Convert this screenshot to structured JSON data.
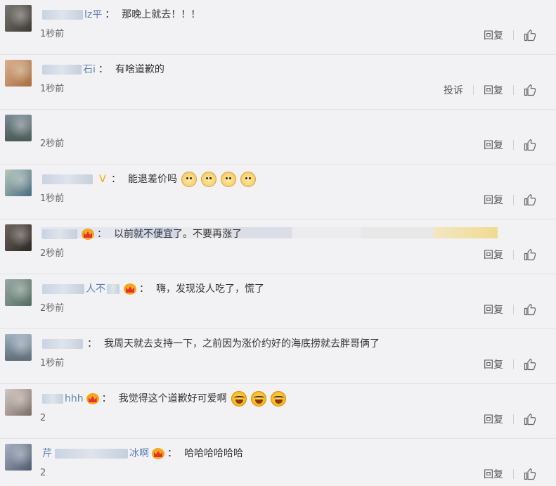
{
  "comments": [
    {
      "avatar": "avatar",
      "username_suffix": "lz平",
      "text": "那晚上就去！！！",
      "time": "1秒前",
      "reply_label": "回复",
      "report_label": ""
    },
    {
      "avatar": "avatar",
      "username_suffix": "石i",
      "text": "有啥道歉的",
      "time": "1秒前",
      "reply_label": "回复",
      "report_label": "投诉"
    },
    {
      "avatar": "avatar",
      "username_suffix": "",
      "text": "",
      "time": "2秒前",
      "reply_label": "回复",
      "report_label": ""
    },
    {
      "avatar": "avatar",
      "username_suffix": "",
      "text": "能退差价吗",
      "time": "1秒前",
      "reply_label": "回复",
      "report_label": ""
    },
    {
      "avatar": "avatar",
      "username_suffix": "",
      "text": "以前就不便宜了。不要再涨了",
      "time": "2秒前",
      "reply_label": "回复",
      "report_label": ""
    },
    {
      "avatar": "avatar",
      "username_suffix": "人不",
      "text": "嗨，发现没人吃了，慌了",
      "time": "2秒前",
      "reply_label": "回复",
      "report_label": ""
    },
    {
      "avatar": "avatar",
      "username_suffix": "",
      "text": "我周天就去支持一下，之前因为涨价约好的海底捞就去胖哥俩了",
      "time": "1秒前",
      "reply_label": "回复",
      "report_label": ""
    },
    {
      "avatar": "avatar",
      "username_suffix": "hhh",
      "text": "我觉得这个道歉好可爱啊",
      "time": "2",
      "reply_label": "回复",
      "report_label": ""
    },
    {
      "avatar": "avatar",
      "username_suffix": "冰啊",
      "username_prefix": "芹",
      "text": "哈哈哈哈哈哈",
      "time": "2",
      "reply_label": "回复",
      "report_label": ""
    }
  ],
  "icons": {
    "like": "thumbs-up-icon",
    "badge_v": "v-badge-icon",
    "crown": "crown-badge-icon",
    "dog_emoji": "doge-emoji-icon",
    "laugh_emoji": "laugh-cry-emoji-icon"
  },
  "colors": {
    "background": "#f2f2f5",
    "username": "#5b7fb4",
    "text": "#333333",
    "meta": "#666666"
  }
}
